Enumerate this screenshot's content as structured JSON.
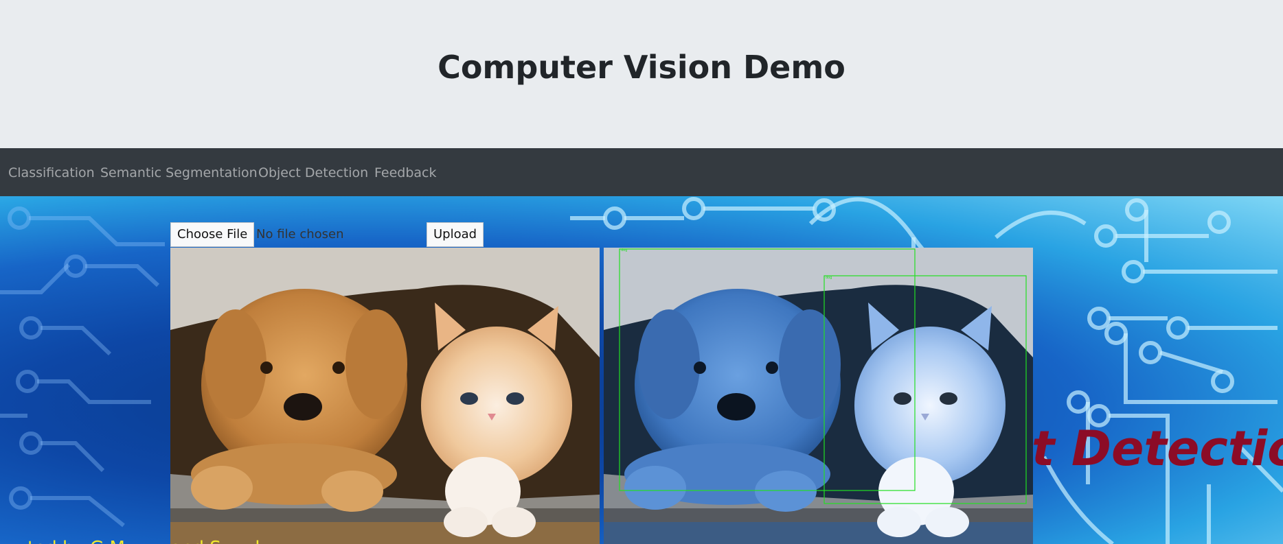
{
  "header": {
    "title": "Computer Vision Demo"
  },
  "nav": {
    "items": [
      {
        "label": "Classification"
      },
      {
        "label": "Semantic Segmentation"
      },
      {
        "label": "Object Detection"
      },
      {
        "label": "Feedback"
      }
    ]
  },
  "upload": {
    "choose_file_label": "Choose File",
    "no_file_text": "No file chosen",
    "upload_label": "Upload"
  },
  "detections": [
    {
      "label": "dog"
    },
    {
      "label": "dog"
    }
  ],
  "background": {
    "banner_text": "t Detection",
    "footer_text": "ted by G M ...... and S..... k"
  },
  "colors": {
    "navbar": "#343a40",
    "nav_text": "rgba(255,255,255,0.55)",
    "jumbotron": "#e9ecef",
    "box": "#22e022",
    "banner": "#8c0c26"
  }
}
